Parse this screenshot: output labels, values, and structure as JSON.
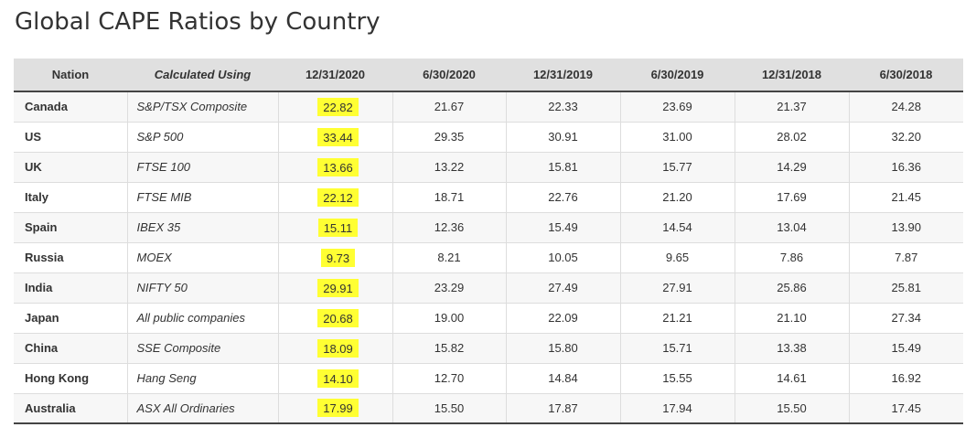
{
  "page": {
    "title": "Global CAPE Ratios by Country"
  },
  "colors": {
    "highlight": "#ffff33",
    "header_bg": "#e0e0e0"
  },
  "table": {
    "headers": [
      "Nation",
      "Calculated Using",
      "12/31/2020",
      "6/30/2020",
      "12/31/2019",
      "6/30/2019",
      "12/31/2018",
      "6/30/2018"
    ],
    "highlighted_column": "12/31/2020",
    "rows": [
      {
        "nation": "Canada",
        "method": "S&P/TSX Composite",
        "values": [
          "22.82",
          "21.67",
          "22.33",
          "23.69",
          "21.37",
          "24.28"
        ]
      },
      {
        "nation": "US",
        "method": "S&P 500",
        "values": [
          "33.44",
          "29.35",
          "30.91",
          "31.00",
          "28.02",
          "32.20"
        ]
      },
      {
        "nation": "UK",
        "method": "FTSE 100",
        "values": [
          "13.66",
          "13.22",
          "15.81",
          "15.77",
          "14.29",
          "16.36"
        ]
      },
      {
        "nation": "Italy",
        "method": "FTSE MIB",
        "values": [
          "22.12",
          "18.71",
          "22.76",
          "21.20",
          "17.69",
          "21.45"
        ]
      },
      {
        "nation": "Spain",
        "method": "IBEX 35",
        "values": [
          "15.11",
          "12.36",
          "15.49",
          "14.54",
          "13.04",
          "13.90"
        ]
      },
      {
        "nation": "Russia",
        "method": "MOEX",
        "values": [
          "9.73",
          "8.21",
          "10.05",
          "9.65",
          "7.86",
          "7.87"
        ]
      },
      {
        "nation": "India",
        "method": "NIFTY 50",
        "values": [
          "29.91",
          "23.29",
          "27.49",
          "27.91",
          "25.86",
          "25.81"
        ]
      },
      {
        "nation": "Japan",
        "method": "All public companies",
        "values": [
          "20.68",
          "19.00",
          "22.09",
          "21.21",
          "21.10",
          "27.34"
        ]
      },
      {
        "nation": "China",
        "method": "SSE Composite",
        "values": [
          "18.09",
          "15.82",
          "15.80",
          "15.71",
          "13.38",
          "15.49"
        ]
      },
      {
        "nation": "Hong Kong",
        "method": "Hang Seng",
        "values": [
          "14.10",
          "12.70",
          "14.84",
          "15.55",
          "14.61",
          "16.92"
        ]
      },
      {
        "nation": "Australia",
        "method": "ASX All Ordinaries",
        "values": [
          "17.99",
          "15.50",
          "17.87",
          "17.94",
          "15.50",
          "17.45"
        ]
      }
    ]
  }
}
